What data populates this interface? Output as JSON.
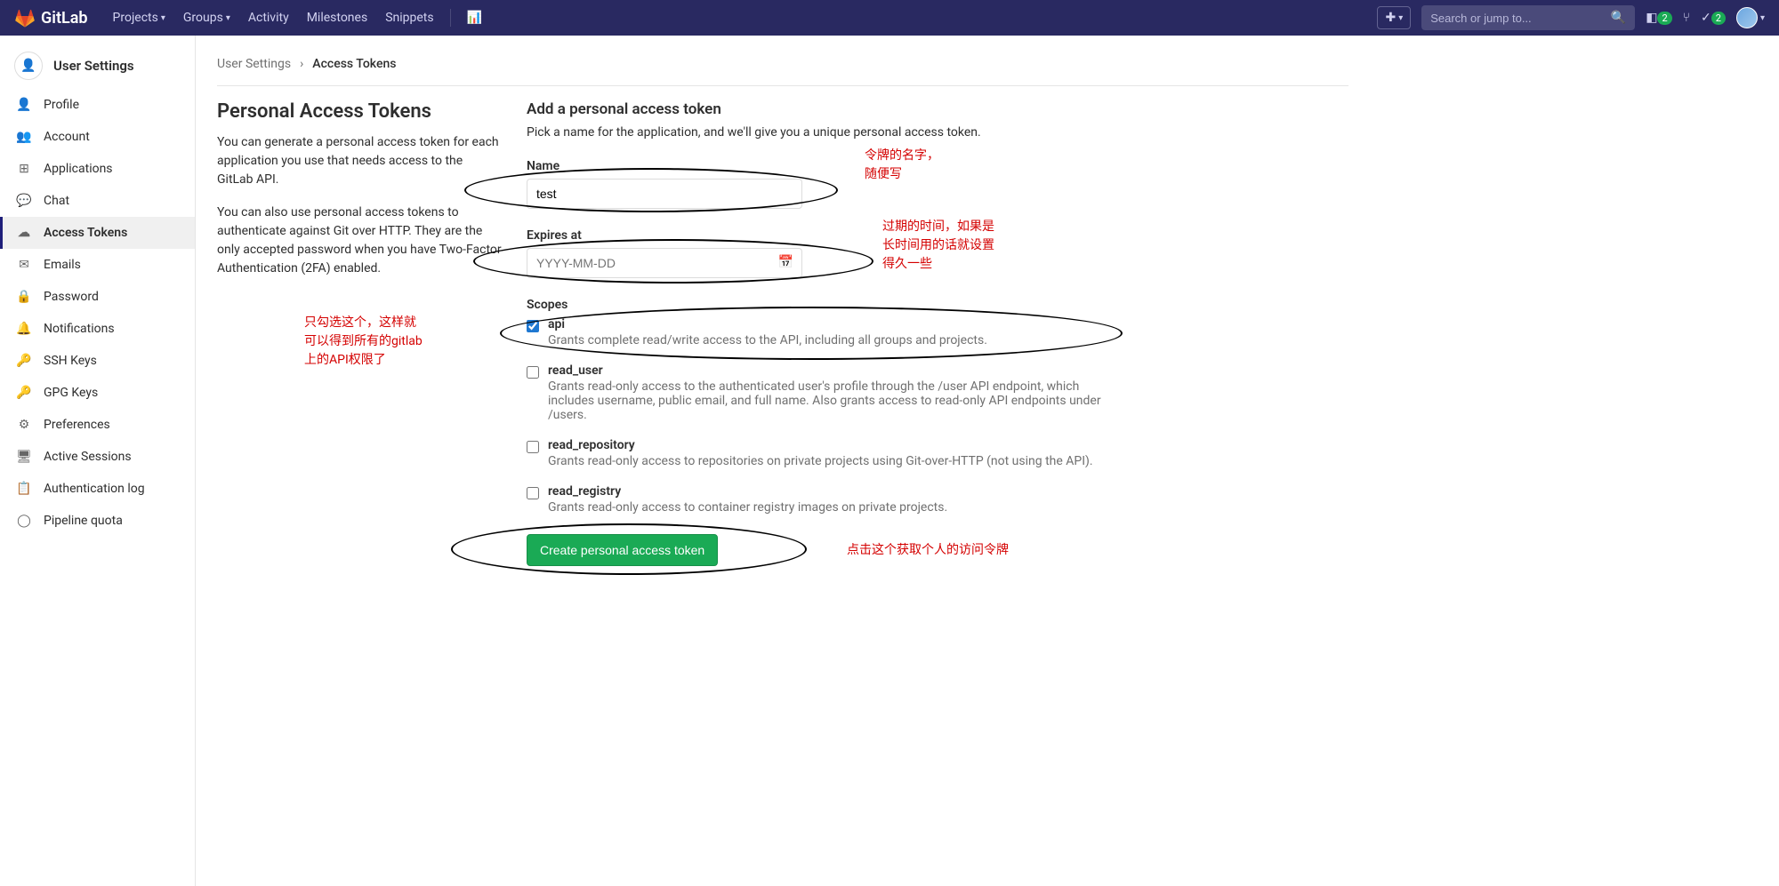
{
  "nav": {
    "brand": "GitLab",
    "items": [
      "Projects",
      "Groups",
      "Activity",
      "Milestones",
      "Snippets"
    ],
    "search_placeholder": "Search or jump to...",
    "issues_badge": "2",
    "todos_badge": "2"
  },
  "sidebar": {
    "title": "User Settings",
    "items": [
      {
        "label": "Profile",
        "icon": "👤"
      },
      {
        "label": "Account",
        "icon": "👥"
      },
      {
        "label": "Applications",
        "icon": "⊞"
      },
      {
        "label": "Chat",
        "icon": "💬"
      },
      {
        "label": "Access Tokens",
        "icon": "☁",
        "active": true
      },
      {
        "label": "Emails",
        "icon": "✉"
      },
      {
        "label": "Password",
        "icon": "🔒"
      },
      {
        "label": "Notifications",
        "icon": "🔔"
      },
      {
        "label": "SSH Keys",
        "icon": "🔑"
      },
      {
        "label": "GPG Keys",
        "icon": "🔑"
      },
      {
        "label": "Preferences",
        "icon": "⚙"
      },
      {
        "label": "Active Sessions",
        "icon": "🖥"
      },
      {
        "label": "Authentication log",
        "icon": "📋"
      },
      {
        "label": "Pipeline quota",
        "icon": "◯"
      }
    ]
  },
  "breadcrumb": {
    "root": "User Settings",
    "current": "Access Tokens"
  },
  "left": {
    "heading": "Personal Access Tokens",
    "p1": "You can generate a personal access token for each application you use that needs access to the GitLab API.",
    "p2": "You can also use personal access tokens to authenticate against Git over HTTP. They are the only accepted password when you have Two-Factor Authentication (2FA) enabled."
  },
  "form": {
    "heading": "Add a personal access token",
    "hint": "Pick a name for the application, and we'll give you a unique personal access token.",
    "name_label": "Name",
    "name_value": "test",
    "expires_label": "Expires at",
    "expires_placeholder": "YYYY-MM-DD",
    "scopes_label": "Scopes",
    "scopes": [
      {
        "key": "api",
        "checked": true,
        "desc": "Grants complete read/write access to the API, including all groups and projects."
      },
      {
        "key": "read_user",
        "checked": false,
        "desc": "Grants read-only access to the authenticated user's profile through the /user API endpoint, which includes username, public email, and full name. Also grants access to read-only API endpoints under /users."
      },
      {
        "key": "read_repository",
        "checked": false,
        "desc": "Grants read-only access to repositories on private projects using Git-over-HTTP (not using the API)."
      },
      {
        "key": "read_registry",
        "checked": false,
        "desc": "Grants read-only access to container registry images on private projects."
      }
    ],
    "submit": "Create personal access token"
  },
  "annotations": {
    "name_note": "令牌的名字，\n随便写",
    "expires_note": "过期的时间，如果是\n长时间用的话就设置\n得久一些",
    "scope_note": "只勾选这个，这样就\n可以得到所有的gitlab\n上的API权限了",
    "submit_note": "点击这个获取个人的访问令牌"
  }
}
